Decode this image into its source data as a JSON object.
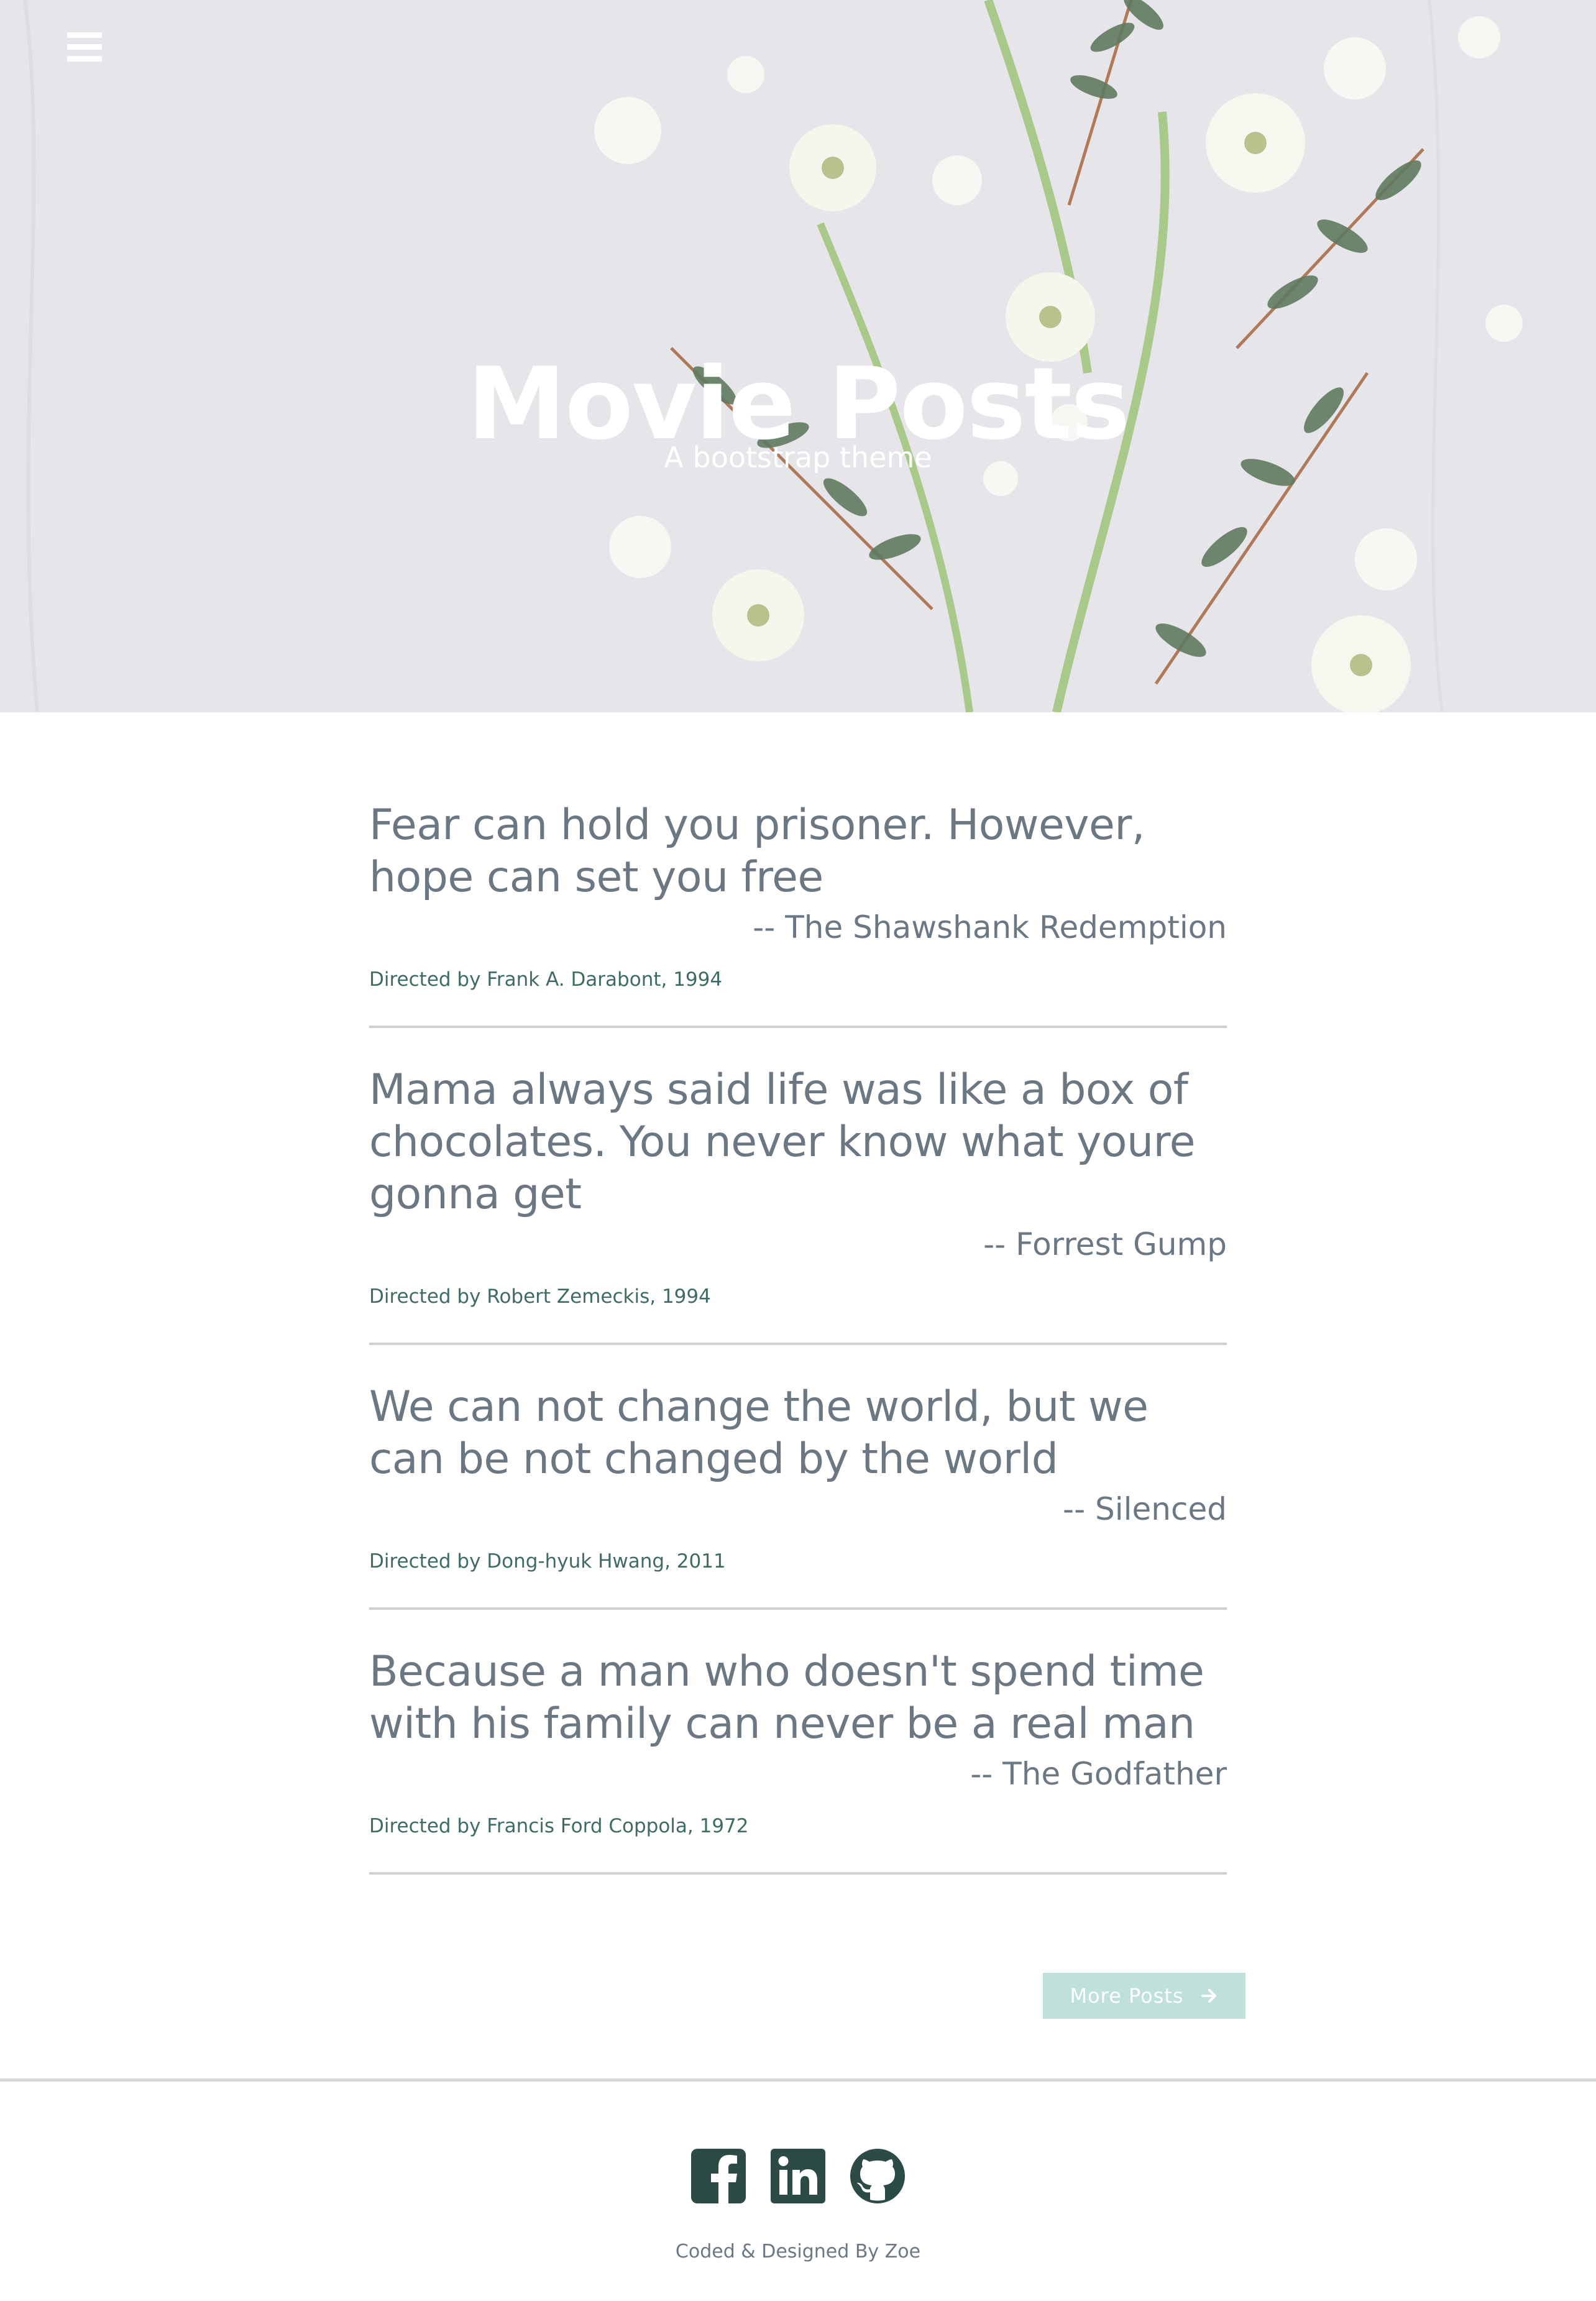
{
  "header": {
    "title": "Movie Posts",
    "subtitle": "A bootstrap theme",
    "menu_icon": "hamburger-menu-icon"
  },
  "posts": [
    {
      "quote": "Fear can hold you prisoner. However, hope can set you free",
      "movie": "-- The Shawshank Redemption",
      "meta": "Directed by Frank A. Darabont, 1994"
    },
    {
      "quote": "Mama always said life was like a box of chocolates. You never know what youre gonna get",
      "movie": "-- Forrest Gump",
      "meta": "Directed by Robert Zemeckis, 1994"
    },
    {
      "quote": "We can not change the world, but we can be not changed by the world",
      "movie": "-- Silenced",
      "meta": "Directed by Dong-hyuk Hwang, 2011"
    },
    {
      "quote": "Because a man who doesn't spend time with his family can never be a real man",
      "movie": "-- The Godfather",
      "meta": "Directed by Francis Ford Coppola, 1972"
    }
  ],
  "more_button": {
    "label": "More Posts",
    "icon": "arrow-right-icon"
  },
  "footer": {
    "social_icons": [
      "facebook-icon",
      "linkedin-icon",
      "github-icon"
    ],
    "credit": "Coded & Designed By Zoe"
  },
  "colors": {
    "text_muted": "#6b7884",
    "meta_green": "#3f6b66",
    "button_bg": "#bfe1da",
    "icon_dark": "#2c4a46",
    "divider": "#cfd2d5"
  }
}
